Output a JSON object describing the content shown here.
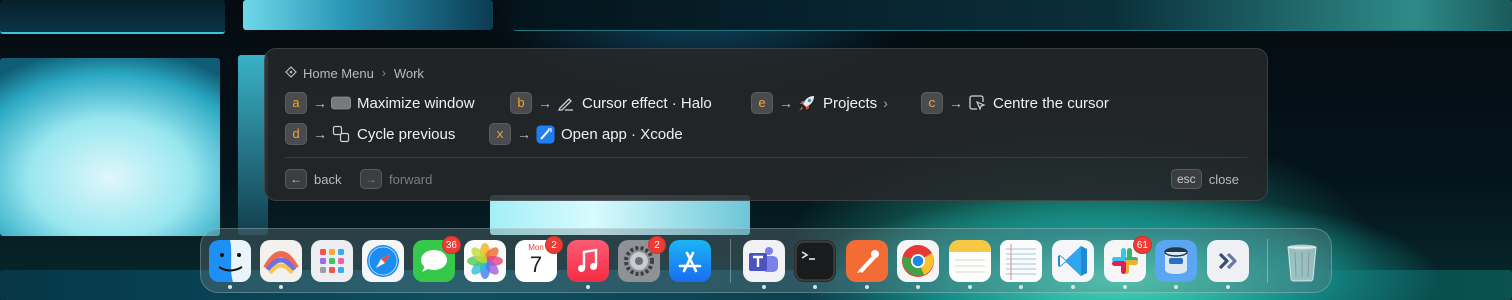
{
  "hud": {
    "breadcrumb": {
      "root": "Home Menu",
      "current": "Work"
    },
    "items": [
      {
        "key": "a",
        "label": "Maximize window",
        "icon": "window-icon"
      },
      {
        "key": "b",
        "label": "Cursor effect · Halo",
        "icon": "pen-icon"
      },
      {
        "key": "e",
        "label": "Projects",
        "icon": "rocket-icon",
        "submenu": true
      },
      {
        "key": "c",
        "label": "Centre the cursor",
        "icon": "cursor-box-icon"
      },
      {
        "key": "d",
        "label": "Cycle previous",
        "icon": "cycle-windows-icon"
      },
      {
        "key": "x",
        "label": "Open app · Xcode",
        "icon": "xcode-icon"
      }
    ],
    "footer": {
      "back_key": "←",
      "back_label": "back",
      "forward_key": "→",
      "forward_label": "forward",
      "close_key": "esc",
      "close_label": "close"
    }
  },
  "dock": {
    "apps": [
      {
        "name": "Finder",
        "running": true
      },
      {
        "name": "Arc",
        "running": true
      },
      {
        "name": "Launchpad",
        "running": false
      },
      {
        "name": "Safari",
        "running": false
      },
      {
        "name": "Messages",
        "badge": "36",
        "running": false
      },
      {
        "name": "Photos",
        "running": false
      },
      {
        "name": "Calendar",
        "badge": "2",
        "month": "Mon",
        "day": "7",
        "running": false
      },
      {
        "name": "Music",
        "running": true
      },
      {
        "name": "System Settings",
        "badge": "2",
        "running": false
      },
      {
        "name": "App Store",
        "running": false
      },
      {
        "name": "Microsoft Teams",
        "running": true
      },
      {
        "name": "Terminal",
        "running": true
      },
      {
        "name": "Postman",
        "running": true
      },
      {
        "name": "Chrome",
        "running": true
      },
      {
        "name": "Notes",
        "running": true
      },
      {
        "name": "TextEdit",
        "running": true
      },
      {
        "name": "VS Code",
        "running": true
      },
      {
        "name": "Slack",
        "badge": "61",
        "running": true
      },
      {
        "name": "Sequel Ace",
        "running": true
      },
      {
        "name": "Superwhisper",
        "running": true
      },
      {
        "name": "Trash",
        "running": false
      }
    ]
  },
  "colors": {
    "key_accent": "#f2a531",
    "badge": "#ef3b34"
  }
}
